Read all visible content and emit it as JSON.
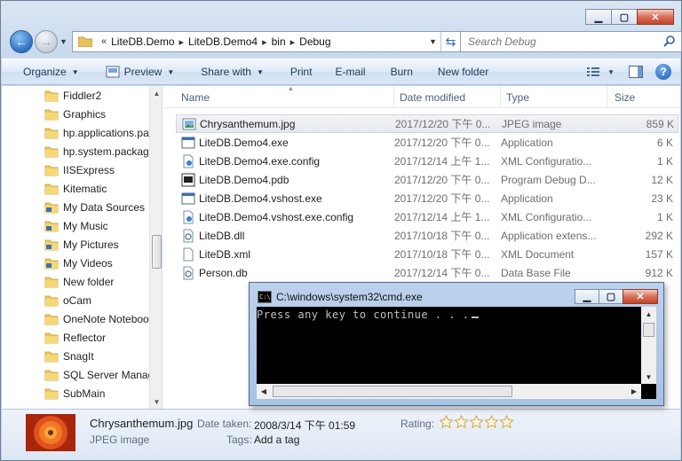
{
  "address": {
    "overflow": "«",
    "crumbs": [
      "LiteDB.Demo",
      "LiteDB.Demo4",
      "bin",
      "Debug"
    ]
  },
  "search": {
    "placeholder": "Search Debug"
  },
  "toolbar": {
    "organize": "Organize",
    "preview": "Preview",
    "share_with": "Share with",
    "print": "Print",
    "email": "E-mail",
    "burn": "Burn",
    "new_folder": "New folder"
  },
  "nav": {
    "items": [
      {
        "label": "Fiddler2",
        "icon": "folder-icon"
      },
      {
        "label": "Graphics",
        "icon": "folder-icon"
      },
      {
        "label": "hp.applications.pa",
        "icon": "folder-icon"
      },
      {
        "label": "hp.system.packag",
        "icon": "folder-icon"
      },
      {
        "label": "IISExpress",
        "icon": "folder-icon"
      },
      {
        "label": "Kitematic",
        "icon": "folder-icon"
      },
      {
        "label": "My Data Sources",
        "icon": "special-folder-icon"
      },
      {
        "label": "My Music",
        "icon": "special-folder-icon"
      },
      {
        "label": "My Pictures",
        "icon": "special-folder-icon"
      },
      {
        "label": "My Videos",
        "icon": "special-folder-icon"
      },
      {
        "label": "New folder",
        "icon": "folder-icon"
      },
      {
        "label": "oCam",
        "icon": "folder-icon"
      },
      {
        "label": "OneNote Noteboo",
        "icon": "folder-icon"
      },
      {
        "label": "Reflector",
        "icon": "folder-icon"
      },
      {
        "label": "SnagIt",
        "icon": "folder-icon"
      },
      {
        "label": "SQL Server Manag",
        "icon": "folder-icon"
      },
      {
        "label": "SubMain",
        "icon": "folder-icon"
      }
    ]
  },
  "columns": {
    "name": "Name",
    "date": "Date modified",
    "type": "Type",
    "size": "Size"
  },
  "files": [
    {
      "name": "Chrysanthemum.jpg",
      "date": "2017/12/20 下午 0...",
      "type": "JPEG image",
      "size": "859 K",
      "icon": "image-file-icon"
    },
    {
      "name": "LiteDB.Demo4.exe",
      "date": "2017/12/20 下午 0...",
      "type": "Application",
      "size": "6 K",
      "icon": "exe-file-icon"
    },
    {
      "name": "LiteDB.Demo4.exe.config",
      "date": "2017/12/14 上午 1...",
      "type": "XML Configuratio...",
      "size": "1 K",
      "icon": "config-file-icon"
    },
    {
      "name": "LiteDB.Demo4.pdb",
      "date": "2017/12/20 下午 0...",
      "type": "Program Debug D...",
      "size": "12 K",
      "icon": "pdb-file-icon"
    },
    {
      "name": "LiteDB.Demo4.vshost.exe",
      "date": "2017/12/20 下午 0...",
      "type": "Application",
      "size": "23 K",
      "icon": "exe-file-icon"
    },
    {
      "name": "LiteDB.Demo4.vshost.exe.config",
      "date": "2017/12/14 上午 1...",
      "type": "XML Configuratio...",
      "size": "1 K",
      "icon": "config-file-icon"
    },
    {
      "name": "LiteDB.dll",
      "date": "2017/10/18 下午 0...",
      "type": "Application extens...",
      "size": "292 K",
      "icon": "dll-file-icon"
    },
    {
      "name": "LiteDB.xml",
      "date": "2017/10/18 下午 0...",
      "type": "XML Document",
      "size": "157 K",
      "icon": "document-file-icon"
    },
    {
      "name": "Person.db",
      "date": "2017/12/14 下午 0...",
      "type": "Data Base File",
      "size": "912 K",
      "icon": "db-file-icon"
    }
  ],
  "details": {
    "name": "Chrysanthemum.jpg",
    "type": "JPEG image",
    "date_label": "Date taken:",
    "date_value": "2008/3/14 下午 01:59",
    "tags_label": "Tags:",
    "tags_value": "Add a tag",
    "rating_label": "Rating:",
    "rating": 0,
    "rating_max": 5
  },
  "cmd": {
    "title": "C:\\windows\\system32\\cmd.exe",
    "output": "Press any key to continue . . .",
    "icon_text": "C:\\"
  }
}
